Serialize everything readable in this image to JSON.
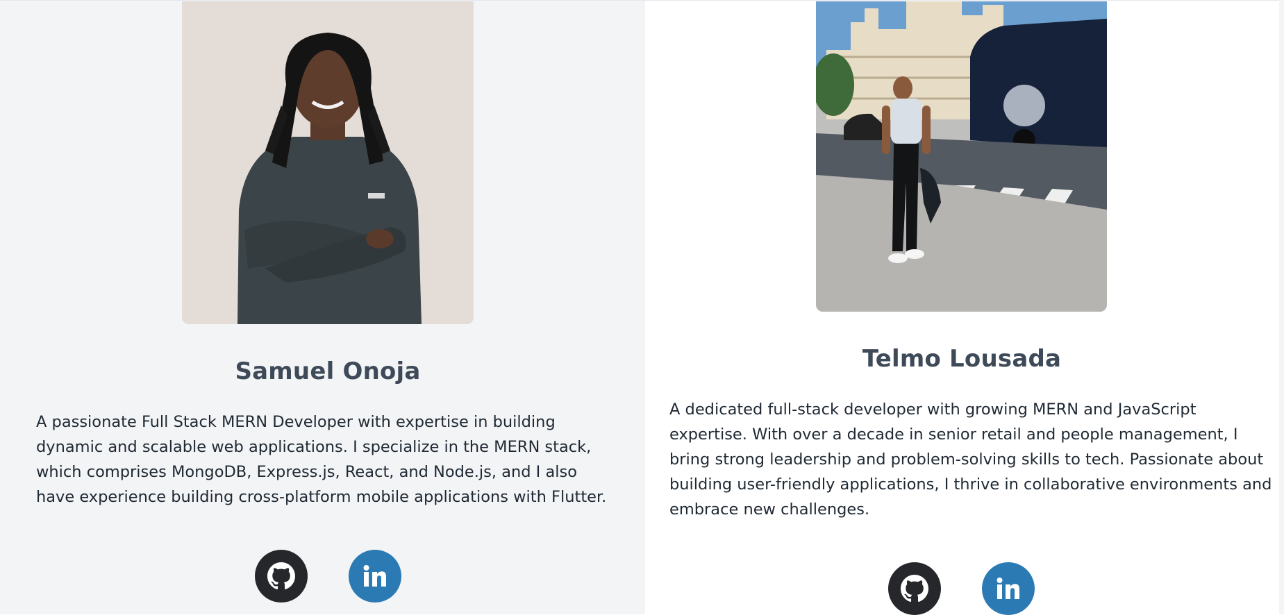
{
  "members": [
    {
      "name": "Samuel Onoja",
      "photo_alt": "Samuel Onoja",
      "bio": "A passionate Full Stack MERN Developer with expertise in building dynamic and scalable web applications. I specialize in the MERN stack, which comprises MongoDB, Express.js, React, and Node.js, and I also have experience building cross-platform mobile applications with Flutter.",
      "links": {
        "github_icon": "github-icon",
        "linkedin_icon": "linkedin-icon"
      }
    },
    {
      "name": "Telmo Lousada",
      "photo_alt": "Telmo Lousada",
      "bio": "A dedicated full-stack developer with growing MERN and JavaScript expertise. With over a decade in senior retail and people management, I bring strong leadership and problem-solving skills to tech. Passionate about building user-friendly applications, I thrive in collaborative environments and embrace new challenges.",
      "links": {
        "github_icon": "github-icon",
        "linkedin_icon": "linkedin-icon"
      }
    }
  ],
  "colors": {
    "github_bg": "#25272b",
    "linkedin_bg": "#2b7ab4",
    "name_text": "#3f4a59",
    "left_card_bg": "#f3f4f6"
  }
}
